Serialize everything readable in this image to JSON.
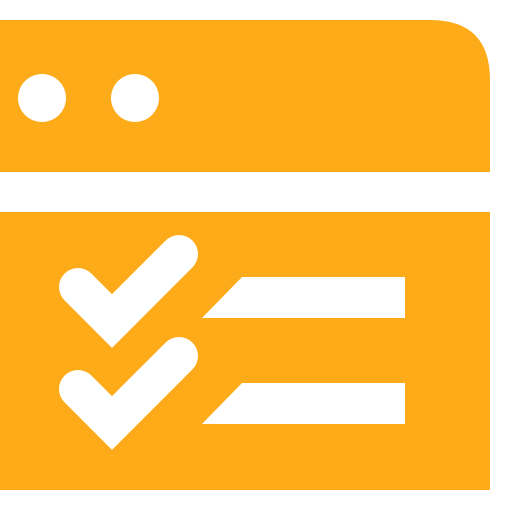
{
  "icon": {
    "name": "browser-checklist-icon",
    "color": "#fdab19",
    "foreground": "#ffffff",
    "window_controls": [
      "circle",
      "circle"
    ],
    "checklist_items": [
      {
        "state": "checked"
      },
      {
        "state": "checked"
      }
    ]
  }
}
